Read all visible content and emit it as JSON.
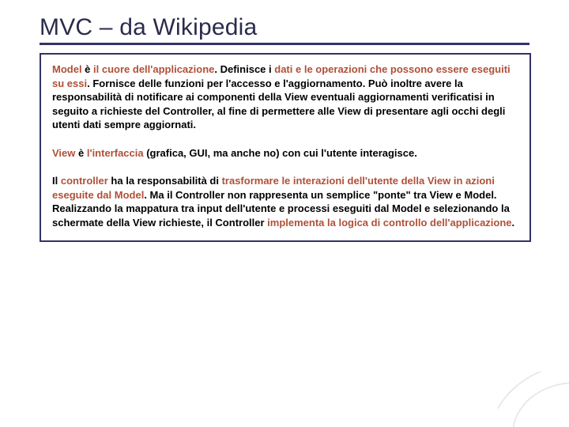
{
  "title": "MVC –  da Wikipedia",
  "paragraphs": {
    "model": {
      "s0": "Model",
      "t0": " è ",
      "s1": "il cuore dell'applicazione",
      "t1": ". Definisce i ",
      "s2": "dati e le operazioni che possono essere eseguiti su essi",
      "t2": ". Fornisce delle funzioni per l'accesso e l'aggiornamento. Può inoltre avere la responsabilità di notificare ai componenti della View eventuali aggiornamenti verificatisi in seguito a richieste del Controller, al fine di permettere alle View di presentare agli occhi degli utenti dati sempre aggiornati."
    },
    "view": {
      "s0": "View",
      "t0": " è ",
      "s1": "l'interfaccia",
      "t1": " (grafica, GUI, ma anche no) con cui l'utente interagisce."
    },
    "controller": {
      "t0": "Il ",
      "s0": "controller",
      "t1": " ha la responsabilità di ",
      "s1": "trasformare le interazioni dell'utente della View in azioni eseguite dal Model",
      "t2": ". Ma il Controller non rappresenta un semplice \"ponte\" tra View e Model. Realizzando la mappatura tra input dell'utente e processi eseguiti dal Model e selezionando la schermate della View richieste, il Controller ",
      "s2": "implementa la logica di controllo dell'applicazione",
      "t3": "."
    }
  }
}
